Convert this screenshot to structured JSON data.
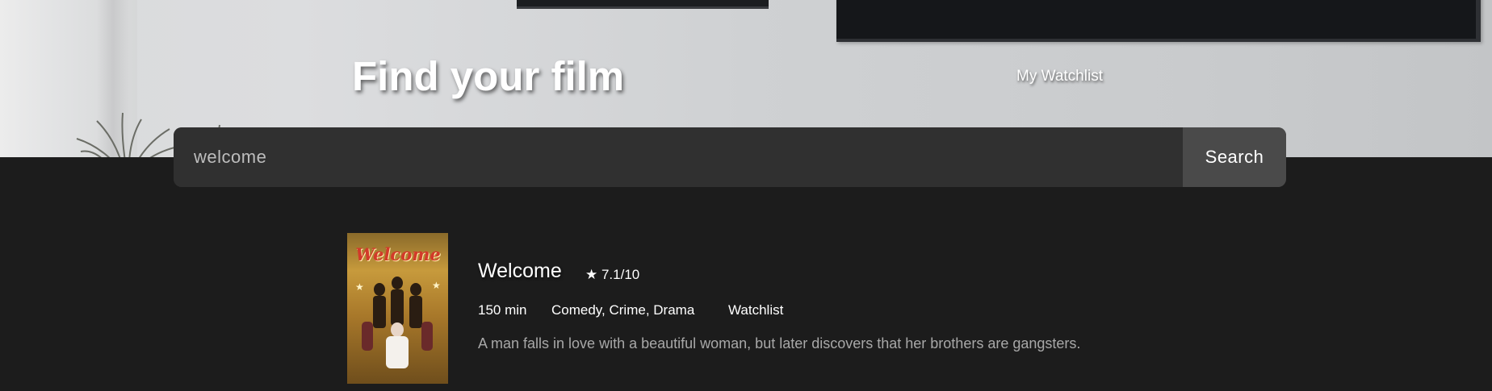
{
  "header": {
    "title": "Find your film",
    "watchlist_link": "My Watchlist"
  },
  "search": {
    "value": "welcome",
    "button_label": "Search"
  },
  "results": [
    {
      "title": "Welcome",
      "rating_icon": "star-icon",
      "rating": "★ 7.1/10",
      "runtime": "150 min",
      "genres": "Comedy, Crime, Drama",
      "watchlist_label": "Watchlist",
      "description": "A man falls in love with a beautiful woman, but later discovers that her brothers are gangsters.",
      "poster_title": "Welcome"
    }
  ],
  "colors": {
    "background": "#1c1c1c",
    "search_bar": "#303030",
    "search_button": "#4a4a4a",
    "text": "#ffffff",
    "muted_text": "#a8a8a8"
  }
}
